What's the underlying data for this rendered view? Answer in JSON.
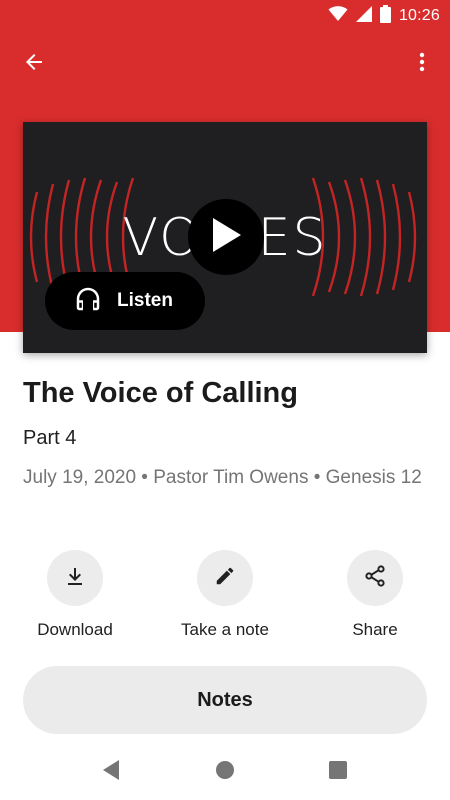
{
  "status_bar": {
    "time": "10:26",
    "icons": [
      "wifi-icon",
      "cell-signal-icon",
      "battery-icon"
    ]
  },
  "app_bar": {
    "back_icon": "arrow-left-icon",
    "menu_icon": "more-vertical-icon"
  },
  "media": {
    "artwork_title": "VOICES",
    "play_icon": "play-icon",
    "listen_label": "Listen",
    "listen_icon": "headphones-icon"
  },
  "sermon": {
    "title": "The Voice of Calling",
    "part": "Part 4",
    "meta": "July 19, 2020 • Pastor Tim Owens • Genesis 12"
  },
  "actions": [
    {
      "label": "Download",
      "icon": "download-icon"
    },
    {
      "label": "Take a note",
      "icon": "pencil-icon"
    },
    {
      "label": "Share",
      "icon": "share-icon"
    }
  ],
  "notes_button": {
    "label": "Notes"
  },
  "colors": {
    "brand_red": "#d92d2d",
    "card_dark": "#1f1f21",
    "wave_red": "#c42424",
    "action_bg": "#ececec"
  }
}
